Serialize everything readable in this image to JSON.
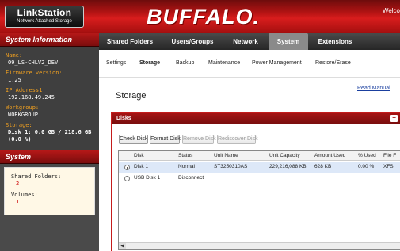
{
  "header": {
    "logo_title": "LinkStation",
    "logo_subtitle": "Network Attached Storage",
    "brand": "BUFFALO.",
    "welcome": "Welco"
  },
  "sidebar": {
    "system_info_title": "System Information",
    "name_label": "Name:",
    "name_value": "O9_LS-CHLV2_DEV",
    "firmware_label": "Firmware version:",
    "firmware_value": "1.25",
    "ip_label": "IP Address1:",
    "ip_value": "192.168.49.245",
    "workgroup_label": "Workgroup:",
    "workgroup_value": "WORKGROUP",
    "storage_label": "Storage:",
    "storage_value": "Disk 1: 0.0 GB / 218.6 GB (0.0 %)",
    "system_title": "System",
    "shared_folders_label": "Shared Folders:",
    "shared_folders_value": "2",
    "volumes_label": "Volumes:",
    "volumes_value": "1"
  },
  "nav": {
    "items": [
      "Shared Folders",
      "Users/Groups",
      "Network",
      "System",
      "Extensions"
    ],
    "active": "System"
  },
  "subnav": {
    "items": [
      "Settings",
      "Storage",
      "Backup",
      "Maintenance",
      "Power Management",
      "Restore/Erase"
    ],
    "active": "Storage"
  },
  "page": {
    "read_manual": "Read Manual",
    "title": "Storage"
  },
  "disks_panel": {
    "title": "Disks",
    "buttons": {
      "check": "Check Disk",
      "format": "Format Disk",
      "remove": "Remove Disk",
      "rediscover": "Rediscover Disk"
    },
    "columns": [
      "Disk",
      "Status",
      "Unit Name",
      "Unit Capacity",
      "Amount Used",
      "% Used",
      "File F"
    ],
    "rows": [
      {
        "selected": true,
        "disk": "Disk 1",
        "status": "Normal",
        "unit_name": "ST3250310AS",
        "capacity": "229,216,088 KB",
        "used": "628 KB",
        "pct": "0.00 %",
        "fs": "XFS"
      },
      {
        "selected": false,
        "disk": "USB Disk 1",
        "status": "Disconnect",
        "unit_name": "",
        "capacity": "",
        "used": "",
        "pct": "",
        "fs": ""
      }
    ]
  },
  "colors": {
    "accent_red": "#c41c1c",
    "sidebar_bg": "#4a4a4a",
    "label_orange": "#f0a020"
  }
}
